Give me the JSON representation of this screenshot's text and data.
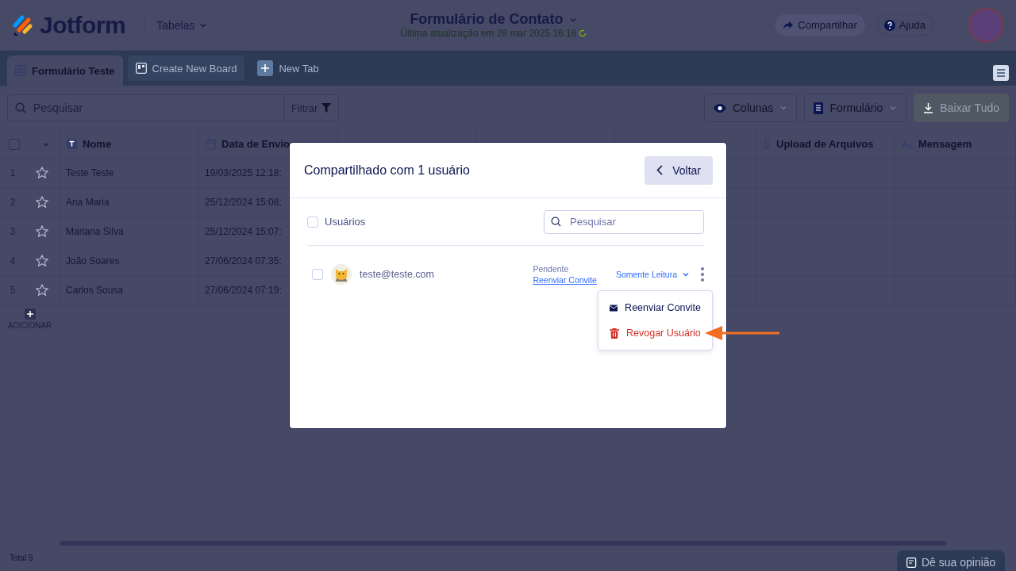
{
  "header": {
    "logo": "Jotform",
    "section": "Tabelas",
    "title": "Formulário de Contato",
    "subtitle": "Última atualização em 28 mar 2025 16:16",
    "buttons": [
      {
        "label": "Compartilhar",
        "kind": "share"
      },
      {
        "label": "Ajuda",
        "kind": "help"
      }
    ]
  },
  "tabs": [
    {
      "label": "Formulário Teste",
      "kind": "table",
      "selected": true
    },
    {
      "label": "Create New Board",
      "kind": "board",
      "selected": false
    },
    {
      "label": "New Tab",
      "kind": "add",
      "selected": false
    }
  ],
  "toolbar": {
    "search_placeholder": "Pesquisar",
    "filter": "Filtrar",
    "buttons": [
      {
        "label": "Colunas",
        "kind": "eye",
        "disabled": false
      },
      {
        "label": "Formulário",
        "kind": "form",
        "disabled": false
      },
      {
        "label": "Baixar Tudo",
        "kind": "download",
        "disabled": true
      }
    ]
  },
  "table": {
    "select_all_checked": false,
    "columns": [
      {
        "kind": "text",
        "label": "Nome"
      },
      {
        "kind": "date",
        "label": "Data de Envio"
      },
      {
        "kind": "covered"
      },
      {
        "kind": "covered"
      },
      {
        "kind": "covered"
      },
      {
        "kind": "file",
        "label": "Upload de Arquivos"
      },
      {
        "kind": "textarea",
        "label": "Mensagem"
      }
    ],
    "rows": [
      {
        "number": "1",
        "starred": false,
        "name": "Teste Teste",
        "date": "19/03/2025 12:18:"
      },
      {
        "number": "2",
        "starred": false,
        "name": "Ana Maria",
        "date": "25/12/2024 15:08:"
      },
      {
        "number": "3",
        "starred": false,
        "name": "Mariana Silva",
        "date": "25/12/2024 15:07:"
      },
      {
        "number": "4",
        "starred": false,
        "name": "João Soares",
        "date": "27/06/2024 07:35:"
      },
      {
        "number": "5",
        "starred": false,
        "name": "Carlos Sousa",
        "date": "27/06/2024 07:19:"
      }
    ],
    "add_label": "ADICIONAR"
  },
  "status_bar": {
    "total": "Total 5",
    "feedback": "Dê sua opinião"
  },
  "modal": {
    "title": "Compartilhado com 1 usuário",
    "back": "Voltar",
    "select_all": {
      "label": "Usuários",
      "checked": false
    },
    "search_placeholder": "Pesquisar",
    "users": [
      {
        "email": "teste@teste.com",
        "checked": false,
        "status": "Pendente",
        "link": "Reenviar Convite",
        "role": "Somente Leitura"
      }
    ],
    "menu": [
      {
        "label": "Reenviar Convite",
        "kind": "mail"
      },
      {
        "label": "Revogar Usuário",
        "kind": "delete"
      }
    ]
  }
}
